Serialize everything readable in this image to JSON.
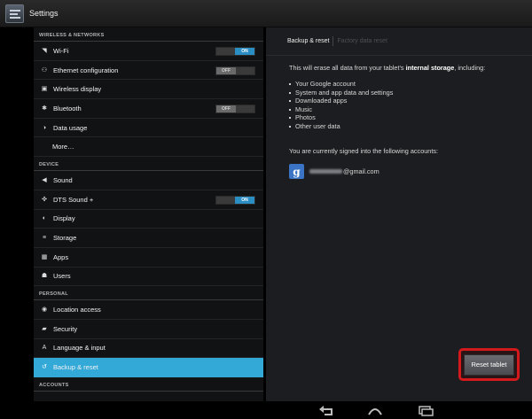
{
  "app": {
    "title": "Settings"
  },
  "sidebar": {
    "sections": [
      {
        "header": "WIRELESS & NETWORKS",
        "items": [
          {
            "label": "Wi-Fi",
            "icon": "wifi-icon",
            "glyph": "◥",
            "toggle": "ON"
          },
          {
            "label": "Ethernet configuration",
            "icon": "ethernet-icon",
            "glyph": "⚇",
            "toggle": "OFF"
          },
          {
            "label": "Wireless display",
            "icon": "display-icon",
            "glyph": "▣"
          },
          {
            "label": "Bluetooth",
            "icon": "bluetooth-icon",
            "glyph": "✱",
            "toggle": "OFF"
          },
          {
            "label": "Data usage",
            "icon": "data-usage-icon",
            "glyph": "◑"
          },
          {
            "label": "More…",
            "icon": ""
          }
        ]
      },
      {
        "header": "DEVICE",
        "items": [
          {
            "label": "Sound",
            "icon": "sound-icon",
            "glyph": "◀"
          },
          {
            "label": "DTS Sound +",
            "icon": "dts-sound-icon",
            "glyph": "✜",
            "toggle": "ON"
          },
          {
            "label": "Display",
            "icon": "brightness-icon",
            "glyph": "◐"
          },
          {
            "label": "Storage",
            "icon": "storage-icon",
            "glyph": "≡"
          },
          {
            "label": "Apps",
            "icon": "apps-icon",
            "glyph": "▦"
          },
          {
            "label": "Users",
            "icon": "users-icon",
            "glyph": "☗"
          }
        ]
      },
      {
        "header": "PERSONAL",
        "items": [
          {
            "label": "Location access",
            "icon": "location-icon",
            "glyph": "◉"
          },
          {
            "label": "Security",
            "icon": "lock-icon",
            "glyph": "▰"
          },
          {
            "label": "Language & input",
            "icon": "language-icon",
            "glyph": "A"
          },
          {
            "label": "Backup & reset",
            "icon": "backup-icon",
            "glyph": "↺",
            "selected": true
          }
        ]
      },
      {
        "header": "ACCOUNTS",
        "items": []
      }
    ]
  },
  "main": {
    "tabs": {
      "active": "Backup & reset",
      "inactive": "Factory data reset"
    },
    "warning_prefix": "This will erase all data from your tablet's ",
    "warning_bold": "internal storage",
    "warning_suffix": ", including:",
    "bullets": [
      "Your Google account",
      "System and app data and settings",
      "Downloaded apps",
      "Music",
      "Photos",
      "Other user data"
    ],
    "accounts_label": "You are currently signed into the following accounts:",
    "account": {
      "icon": "google-icon",
      "glyph": "g",
      "email_suffix": "@gmail.com"
    },
    "reset_button": "Reset tablet"
  },
  "navbar": {
    "back": "back-icon",
    "home": "home-icon",
    "recents": "recents-icon"
  },
  "colors": {
    "accent": "#33a9d8",
    "toggle_on": "#2a8ec4",
    "highlight": "#d3191b"
  }
}
